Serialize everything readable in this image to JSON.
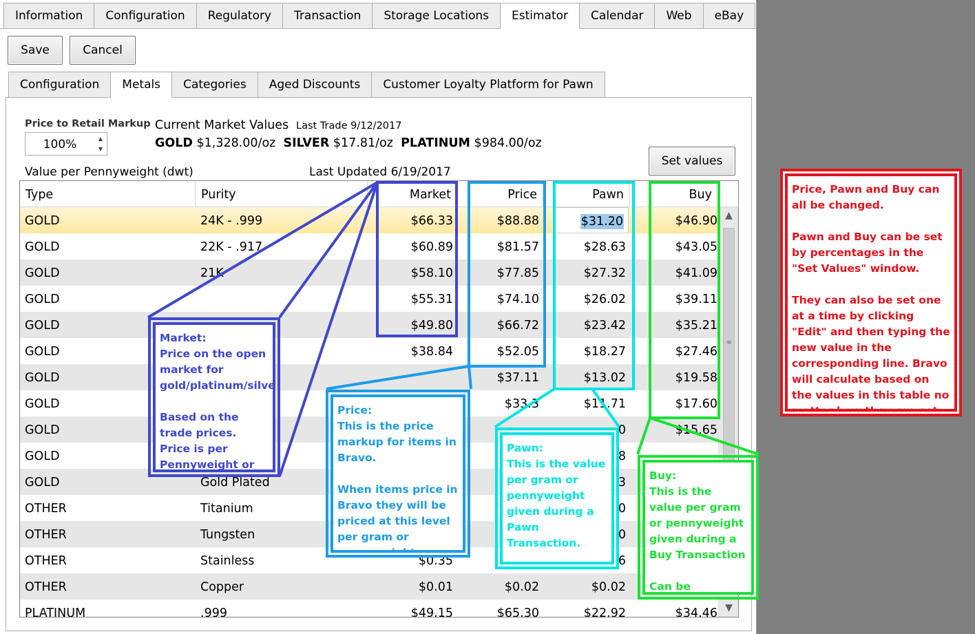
{
  "top_tabs": [
    "Information",
    "Configuration",
    "Regulatory",
    "Transaction",
    "Storage Locations",
    "Estimator",
    "Calendar",
    "Web",
    "eBay"
  ],
  "top_active": "Estimator",
  "toolbar": {
    "save_label": "Save",
    "cancel_label": "Cancel"
  },
  "sub_tabs": [
    "Configuration",
    "Metals",
    "Categories",
    "Aged Discounts",
    "Customer Loyalty Platform for Pawn"
  ],
  "sub_active": "Metals",
  "markup": {
    "label": "Price to Retail Markup",
    "value": "100%"
  },
  "market": {
    "title": "Current Market Values",
    "last_trade": "Last Trade 9/12/2017",
    "gold_label": "GOLD",
    "gold_value": "$1,328.00/oz",
    "silver_label": "SILVER",
    "silver_value": "$17.81/oz",
    "platinum_label": "PLATINUM",
    "platinum_value": "$984.00/oz"
  },
  "set_values_label": "Set values",
  "unit_label": "Value per Pennyweight (dwt)",
  "last_updated": "Last Updated 6/19/2017",
  "columns": {
    "type": "Type",
    "purity": "Purity",
    "market": "Market",
    "price": "Price",
    "pawn": "Pawn",
    "buy": "Buy"
  },
  "rows": [
    {
      "type": "GOLD",
      "purity": "24K - .999",
      "market": "$66.33",
      "price": "$88.88",
      "pawn": "$31.20",
      "buy": "$46.90"
    },
    {
      "type": "GOLD",
      "purity": "22K - .917",
      "market": "$60.89",
      "price": "$81.57",
      "pawn": "$28.63",
      "buy": "$43.05"
    },
    {
      "type": "GOLD",
      "purity": "21K",
      "market": "$58.10",
      "price": "$77.85",
      "pawn": "$27.32",
      "buy": "$41.09"
    },
    {
      "type": "GOLD",
      "purity": "",
      "market": "$55.31",
      "price": "$74.10",
      "pawn": "$26.02",
      "buy": "$39.11"
    },
    {
      "type": "GOLD",
      "purity": "",
      "market": "$49.80",
      "price": "$66.72",
      "pawn": "$23.42",
      "buy": "$35.21"
    },
    {
      "type": "GOLD",
      "purity": "",
      "market": "$38.84",
      "price": "$52.05",
      "pawn": "$18.27",
      "buy": "$27.46"
    },
    {
      "type": "GOLD",
      "purity": "",
      "market": "",
      "price": "$37.11",
      "pawn": "$13.02",
      "buy": "$19.58"
    },
    {
      "type": "GOLD",
      "purity": "",
      "market": "",
      "price": "$33.3",
      "pawn": "$11.71",
      "buy": "$17.60"
    },
    {
      "type": "GOLD",
      "purity": "",
      "market": "",
      "price": "",
      "pawn": "0",
      "buy": "$15.65"
    },
    {
      "type": "GOLD",
      "purity": "",
      "market": "",
      "price": "",
      "pawn": "8",
      "buy": ""
    },
    {
      "type": "GOLD",
      "purity": "Gold Plated",
      "market": "",
      "price": "",
      "pawn": "3",
      "buy": ""
    },
    {
      "type": "OTHER",
      "purity": "Titanium",
      "market": "",
      "price": "",
      "pawn": "0",
      "buy": ""
    },
    {
      "type": "OTHER",
      "purity": "Tungsten",
      "market": "",
      "price": "",
      "pawn": "0",
      "buy": ""
    },
    {
      "type": "OTHER",
      "purity": "Stainless",
      "market": "$0.35",
      "price": "",
      "pawn": "6",
      "buy": ""
    },
    {
      "type": "OTHER",
      "purity": "Copper",
      "market": "$0.01",
      "price": "$0.02",
      "pawn": "$0.02",
      "buy": ""
    },
    {
      "type": "PLATINUM",
      "purity": ".999",
      "market": "$49.15",
      "price": "$65.30",
      "pawn": "$22.92",
      "buy": "$34.46"
    }
  ],
  "notes": {
    "market": "Market:\nPrice on the open market for gold/platinum/silver\n\nBased on the trade prices. Price is per Pennyweight or Gram (store choice)",
    "price": "Price:\nThis is the price markup for items in Bravo.\n\nWhen items price in Bravo they will be priced at this level per gram or pennyweight.",
    "pawn": "Pawn:\nThis is the value per gram or pennyweight given during a Pawn Transaction.\n\nCan be changed.",
    "buy": "Buy:\nThis is the value per gram or pennyweight given during a Buy Transaction\n\nCan be changed.",
    "summary": "Price, Pawn and Buy can all be changed.\n\nPawn and Buy can be set by percentages in the \"Set Values\" window.\n\nThey can also be set one at a time by clicking \"Edit\" and then typing the new value in the corresponding line. Bravo will calculate based on the values in this table no matter how they are set."
  },
  "colors": {
    "market": "#3f48cc",
    "price": "#1e9ce6",
    "pawn": "#00e5e5",
    "buy": "#1ee038",
    "summary": "#e3141e",
    "selected_row": "#ffe8a0"
  }
}
